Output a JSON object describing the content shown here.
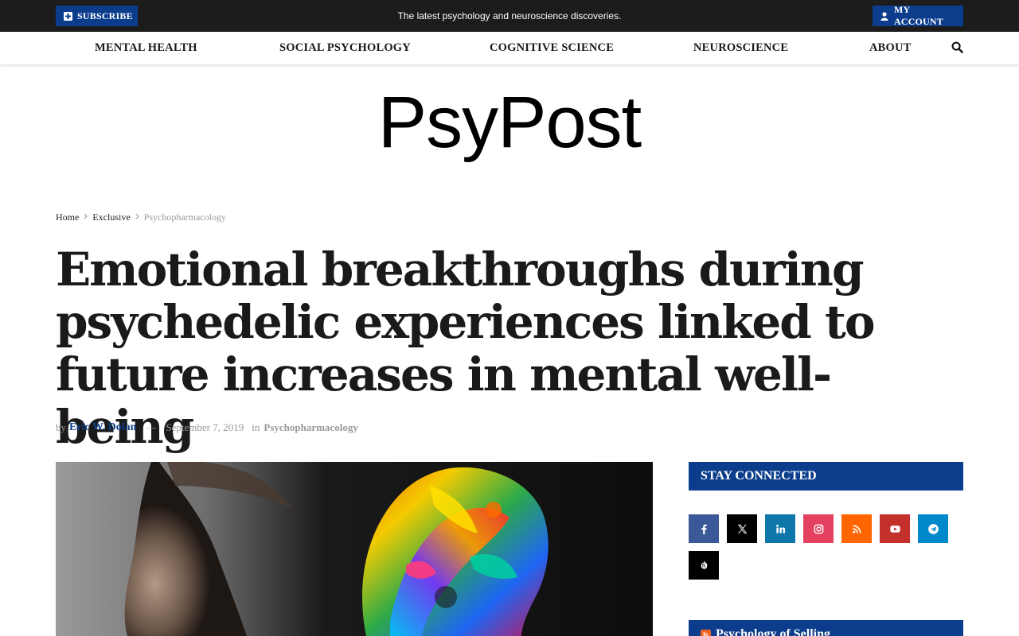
{
  "topbar": {
    "subscribe_label": "SUBSCRIBE",
    "tagline": "The latest psychology and neuroscience discoveries.",
    "account_label": "MY ACCOUNT"
  },
  "nav": {
    "items": [
      {
        "label": "MENTAL HEALTH"
      },
      {
        "label": "SOCIAL PSYCHOLOGY"
      },
      {
        "label": "COGNITIVE SCIENCE"
      },
      {
        "label": "NEUROSCIENCE"
      },
      {
        "label": "ABOUT"
      }
    ],
    "search_icon": "search-icon"
  },
  "logo": "PsyPost",
  "breadcrumb": {
    "items": [
      "Home",
      "Exclusive",
      "Psychopharmacology"
    ]
  },
  "article": {
    "title": "Emotional breakthroughs during psychedelic experiences linked to future increases in mental well-being",
    "by_label": "by",
    "author": "Eric W. Dolan",
    "dash": "—",
    "date": "September 7, 2019",
    "in_label": "in",
    "category": "Psychopharmacology"
  },
  "sidebar": {
    "stay_connected_title": "STAY CONNECTED",
    "social": [
      {
        "name": "facebook",
        "color": "#3b5998"
      },
      {
        "name": "x",
        "color": "#000000"
      },
      {
        "name": "linkedin",
        "color": "#0e76a8"
      },
      {
        "name": "instagram",
        "color": "#e4405f"
      },
      {
        "name": "rss",
        "color": "#ff6600"
      },
      {
        "name": "youtube",
        "color": "#c4302b"
      },
      {
        "name": "telegram",
        "color": "#0088cc"
      },
      {
        "name": "threads",
        "color": "#000000"
      }
    ],
    "selling_title": "Psychology of Selling"
  },
  "colors": {
    "brand_blue": "#0b3d8c",
    "topbar_bg": "#1c1c1c"
  }
}
